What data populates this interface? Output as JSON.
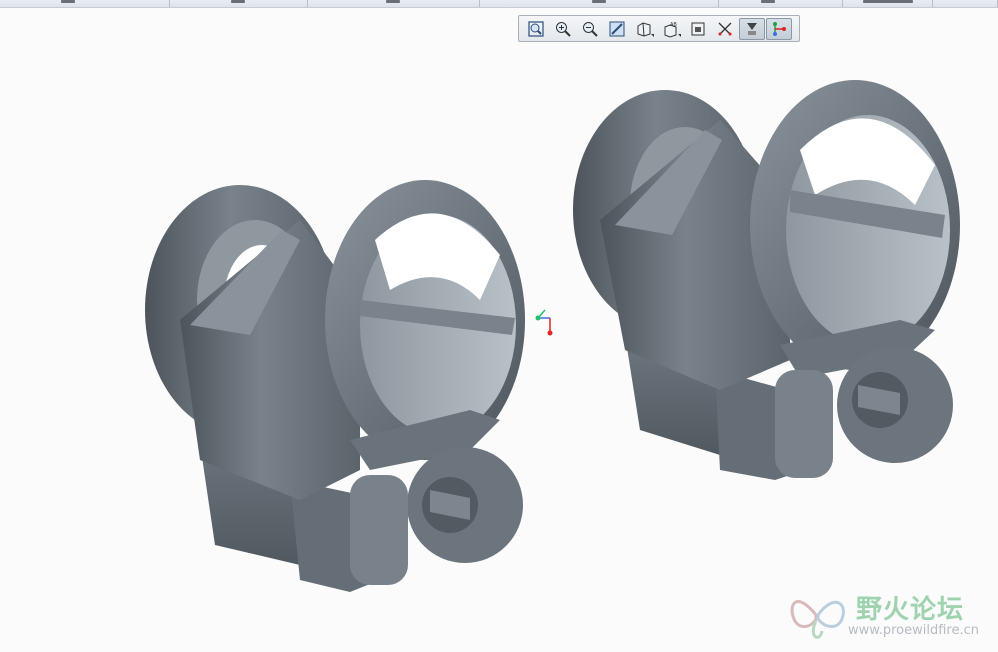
{
  "tabstrip": {
    "tabs": [
      "",
      "",
      "",
      "",
      "",
      "",
      "",
      ""
    ]
  },
  "toolbar": {
    "buttons": [
      {
        "name": "refit-view",
        "icon": "refit-icon",
        "active": false
      },
      {
        "name": "zoom-in",
        "icon": "zoom-in-icon",
        "active": false
      },
      {
        "name": "zoom-out",
        "icon": "zoom-out-icon",
        "active": false
      },
      {
        "name": "repaint",
        "icon": "repaint-icon",
        "active": false
      },
      {
        "name": "display-style",
        "icon": "display-style-icon",
        "active": false,
        "flyout": true
      },
      {
        "name": "saved-orientations",
        "icon": "saved-orientations-icon",
        "active": false,
        "flyout": true
      },
      {
        "name": "view-manager",
        "icon": "view-manager-icon",
        "active": false
      },
      {
        "name": "datum-display",
        "icon": "datum-display-icon",
        "active": false
      },
      {
        "name": "annotation-display",
        "icon": "annotation-display-icon",
        "active": true
      },
      {
        "name": "spin-center",
        "icon": "spin-center-icon",
        "active": true
      }
    ]
  },
  "scene": {
    "part_color": "#6e7780",
    "background": "#fbfbfb",
    "csys_colors": {
      "x": "#e02424",
      "y": "#22c06a",
      "z": "#3b6ee0"
    }
  },
  "watermark": {
    "title": "野火论坛",
    "url": "www.proewildfire.cn"
  }
}
